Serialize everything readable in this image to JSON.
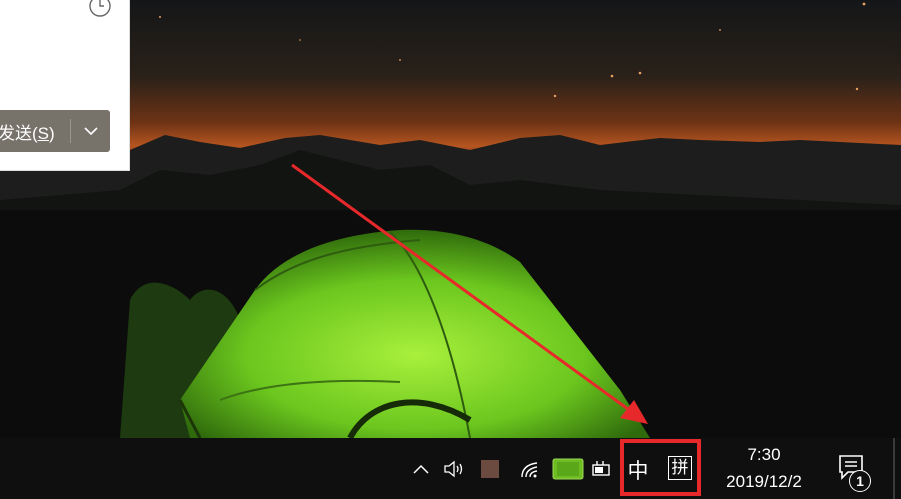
{
  "colors": {
    "taskbar": "#0f0f10",
    "send_button": "#77726a",
    "annotation": "#e8292b",
    "tent_green": "#7bd62b",
    "sky_glow": "#c2581d"
  },
  "chat_popup": {
    "send_label_main": "发送(",
    "send_label_key": "S",
    "send_label_end": ")",
    "history_icon": "clock-icon",
    "dropdown_icon": "chevron-down-icon"
  },
  "taskbar": {
    "tray_icons": [
      "chevron-up-icon",
      "speaker-icon",
      "app-square-icon",
      "wifi-icon",
      "battery-icon",
      "power-plug-icon"
    ],
    "ime_mode": "中",
    "ime_input": "拼",
    "clock_time": "7:30",
    "clock_date": "2019/12/2",
    "notification_count": "1",
    "notification_icon": "action-center-icon"
  }
}
